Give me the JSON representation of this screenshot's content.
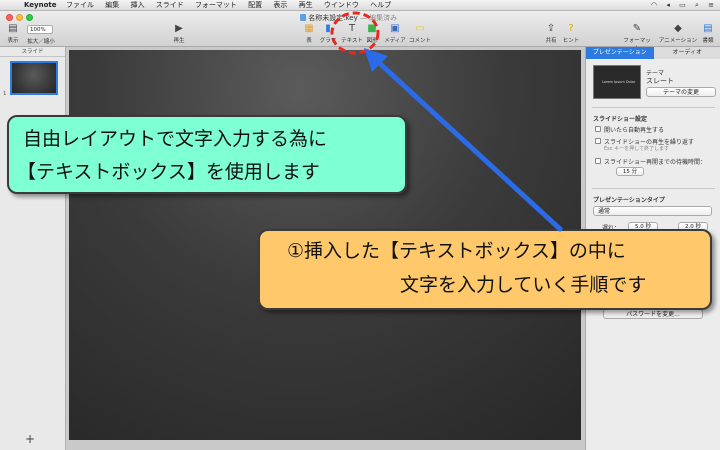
{
  "menubar": {
    "app_name": "Keynote",
    "items": [
      "ファイル",
      "編集",
      "挿入",
      "スライド",
      "フォーマット",
      "配置",
      "表示",
      "再生",
      "ウインドウ",
      "ヘルプ"
    ]
  },
  "window": {
    "doc_name": "名称未設定.key",
    "edited_label": "— 編集済み"
  },
  "toolbar": {
    "zoom_value": "100%",
    "view_label": "表示",
    "zoom_label": "拡大／縮小",
    "play_label": "再生",
    "table_label": "表",
    "chart_label": "グラフ",
    "text_label": "テキスト",
    "shape_label": "図形",
    "media_label": "メディア",
    "comment_label": "コメント",
    "share_label": "共有",
    "tips_label": "ヒント",
    "format_label": "フォーマット",
    "animate_label": "アニメーション",
    "document_label": "書類"
  },
  "navigator": {
    "header": "スライド",
    "slide_number": "1",
    "add_label": "+"
  },
  "inspector": {
    "tab_presentation": "プレゼンテーション",
    "tab_audio": "オーディオ",
    "theme_label": "テーマ",
    "theme_name": "スレート",
    "theme_preview_text": "Lorem Ipsum Dolor",
    "change_theme_button": "テーマの変更",
    "slideshow_settings": "スライドショー設定",
    "autoplay": "開いたら自動再生する",
    "loop": "スライドショーの再生を繰り返す",
    "loop_hint": "Esc キーを押して終了します",
    "idle_restart": "スライドショー再開までの待機時間：",
    "idle_value": "15 分",
    "presentation_type": "プレゼンテーションタイプ",
    "type_value": "通常",
    "delay_label": "遅れ：",
    "delay_value_1": "5.0 秒",
    "delay_value_2": "2.0 秒",
    "password_button": "パスワードを変更..."
  },
  "callouts": {
    "green_line1": "自由レイアウトで文字入力する為に",
    "green_line2": "【テキストボックス】を使用します",
    "orange_line1": "①挿入した【テキストボックス】の中に",
    "orange_line2": "文字を入力していく手順です"
  },
  "colors": {
    "accent": "#2d7be0",
    "callout_green": "#7effd4",
    "callout_orange": "#ffc96b",
    "arrow_blue": "#2b6be8",
    "highlight_red": "#e8281e"
  }
}
